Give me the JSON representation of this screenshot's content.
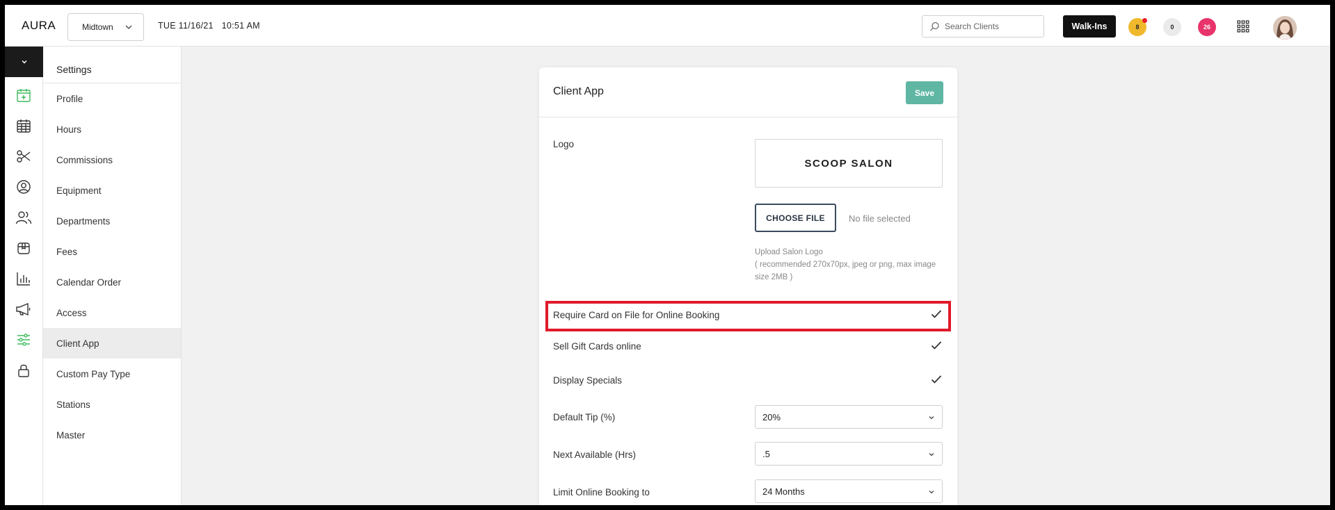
{
  "header": {
    "brand": "AURA",
    "location": "Midtown",
    "date": "TUE 11/16/21",
    "time": "10:51 AM",
    "search_placeholder": "Search Clients",
    "walkins_label": "Walk-Ins",
    "badges": {
      "yellow": "8",
      "grey": "0",
      "pink": "26"
    }
  },
  "rail": {
    "icons": [
      "calendar-add-icon",
      "calendar-grid-icon",
      "scissors-icon",
      "user-circle-icon",
      "users-icon",
      "box-icon",
      "bar-chart-icon",
      "megaphone-icon",
      "sliders-icon",
      "lock-icon"
    ]
  },
  "sidebar": {
    "title": "Settings",
    "items": [
      "Profile",
      "Hours",
      "Commissions",
      "Equipment",
      "Departments",
      "Fees",
      "Calendar Order",
      "Access",
      "Client App",
      "Custom Pay Type",
      "Stations",
      "Master"
    ],
    "active": "Client App"
  },
  "card": {
    "title": "Client App",
    "save_label": "Save",
    "logo_label": "Logo",
    "logo_text": "SCOOP SALON",
    "choose_file_label": "CHOOSE FILE",
    "no_file_text": "No file selected",
    "upload_hint_1": "Upload Salon Logo",
    "upload_hint_2": "( recommended 270x70px, jpeg or png, max image size 2MB )",
    "toggles": [
      {
        "label": "Require Card on File for Online Booking",
        "checked": true
      },
      {
        "label": "Sell Gift Cards online",
        "checked": true
      },
      {
        "label": "Display Specials",
        "checked": true
      }
    ],
    "selects": [
      {
        "label": "Default Tip (%)",
        "value": "20%"
      },
      {
        "label": "Next Available (Hrs)",
        "value": ".5"
      },
      {
        "label": "Limit Online Booking to",
        "value": "24 Months"
      }
    ]
  },
  "colors": {
    "accent_green": "#5fb6a3",
    "rail_active": "#3dbb5c",
    "highlight_red": "#e0192a",
    "badge_yellow": "#f0b92c",
    "badge_pink": "#e8336b"
  }
}
